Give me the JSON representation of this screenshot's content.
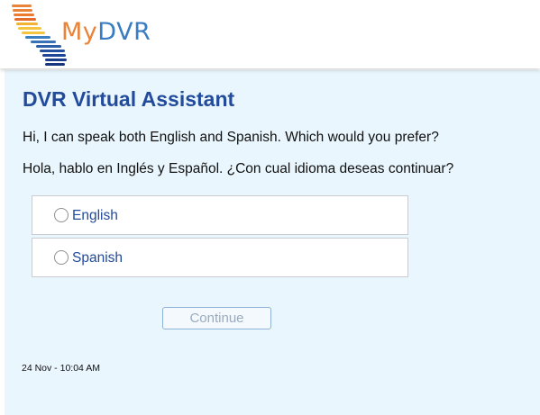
{
  "header": {
    "logo_text_my": "My",
    "logo_text_dvr": "DVR"
  },
  "chat": {
    "title": "DVR Virtual Assistant",
    "message_en": "Hi, I can speak both English and Spanish. Which would you prefer?",
    "message_es": "Hola, hablo en Inglés y Español. ¿Con cual idioma deseas continuar?",
    "options": [
      {
        "label": "English",
        "selected": false
      },
      {
        "label": "Spanish",
        "selected": false
      }
    ],
    "continue_label": "Continue",
    "timestamp": "24 Nov - 10:04 AM"
  },
  "colors": {
    "title": "#234b9b",
    "panel_bg": "#e9f6fd",
    "logo_my": "#e9833a",
    "logo_dvr": "#3a7cc1"
  },
  "icons": {
    "logo": "california-stripes-logo",
    "radio": "radio-unchecked"
  }
}
